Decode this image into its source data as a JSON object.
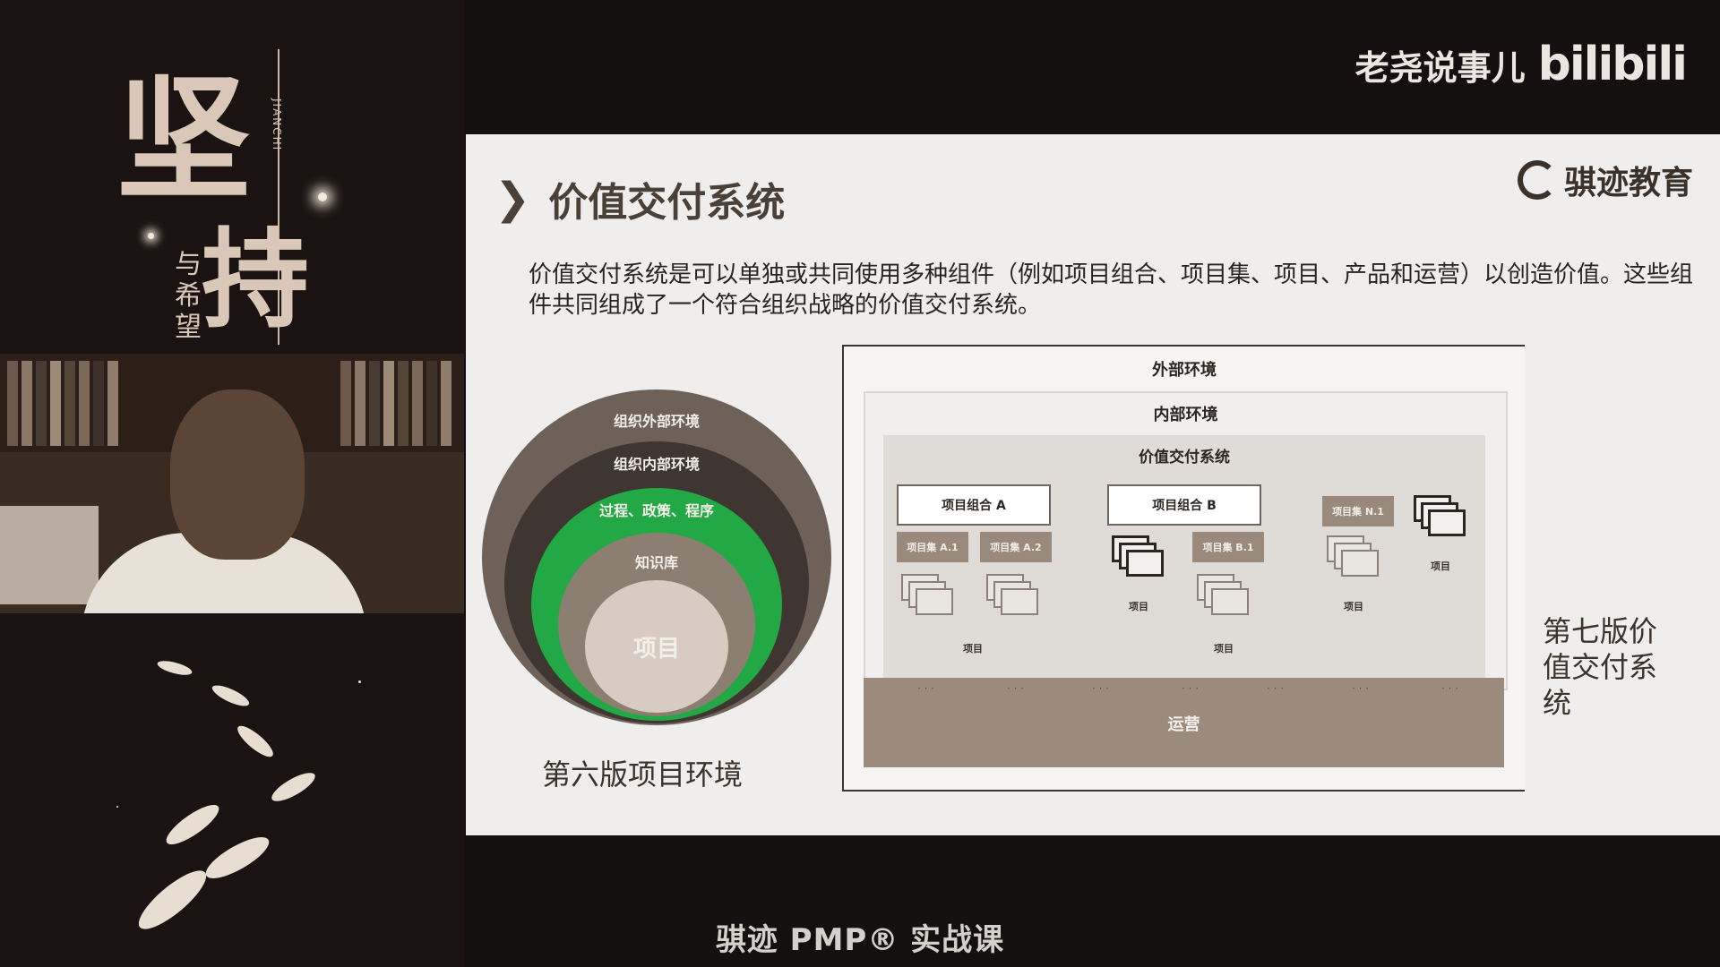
{
  "brand": {
    "channel": "老尧说事儿",
    "site": "bilibili"
  },
  "poster": {
    "title_chars": [
      "坚",
      "持"
    ],
    "pinyin": "JIANCHI",
    "subtitle": [
      "与",
      "希",
      "望"
    ]
  },
  "slide": {
    "title": "价值交付系统",
    "logo": "骐迹教育",
    "description": "价值交付系统是可以单独或共同使用多种组件（例如项目组合、项目集、项目、产品和运营）以创造价值。这些组件共同组成了一个符合组织战略的价值交付系统。",
    "old_env": {
      "outer": "组织外部环境",
      "inner": "组织内部环境",
      "process": "过程、政策、程序",
      "knowledge": "知识库",
      "center": "项目",
      "caption": "第六版项目环境"
    },
    "new_system": {
      "external": "外部环境",
      "internal": "内部环境",
      "vds": "价值交付系统",
      "portfolio_a": "项目组合 A",
      "portfolio_b": "项目组合 B",
      "program_a1": "项目集 A.1",
      "program_a2": "项目集 A.2",
      "program_b1": "项目集 B.1",
      "program_n1": "项目集 N.1",
      "project_label": "项目",
      "operations": "运营",
      "dots": "· · ·",
      "caption": "第七版价值交付系统"
    }
  },
  "footer": {
    "course": "骐迹 PMP® 实战课"
  }
}
